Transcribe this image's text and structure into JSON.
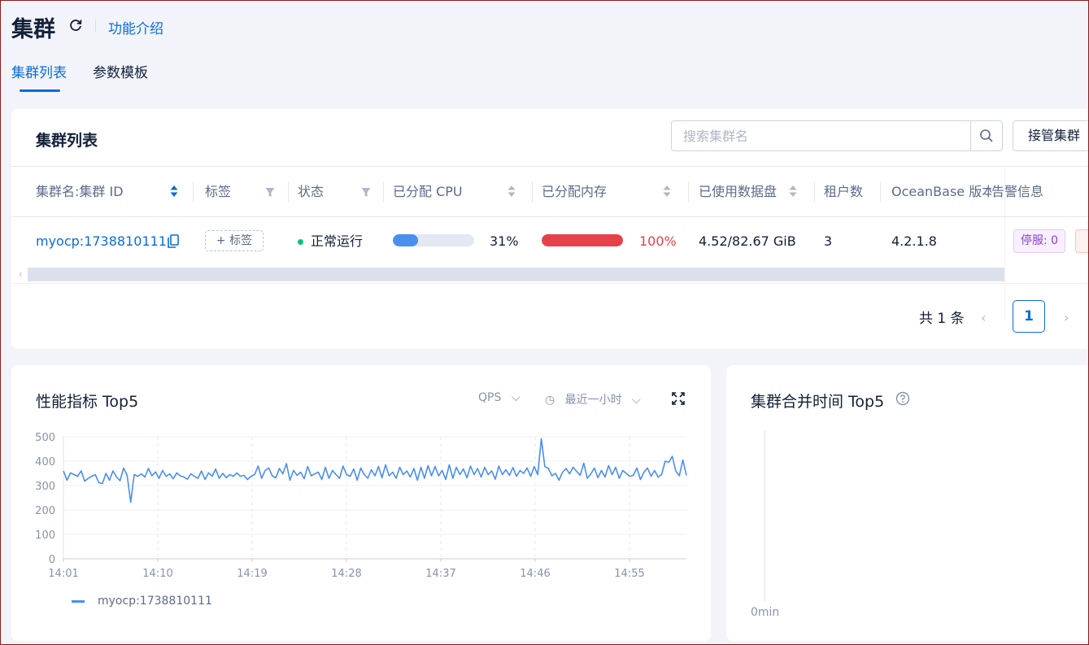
{
  "header": {
    "title": "集群",
    "intro_link": "功能介绍",
    "tabs": [
      {
        "label": "集群列表",
        "active": true
      },
      {
        "label": "参数模板",
        "active": false
      }
    ]
  },
  "cluster_list": {
    "title": "集群列表",
    "search_placeholder": "搜索集群名",
    "takeover_button": "接管集群",
    "columns": [
      "集群名:集群 ID",
      "标签",
      "状态",
      "已分配 CPU",
      "已分配内存",
      "已使用数据盘",
      "租户数",
      "OceanBase 版本号",
      "告警信息"
    ],
    "rows": [
      {
        "name": "myocp:1738810111",
        "tag_button": "标签",
        "status": "正常运行",
        "cpu_pct_label": "31%",
        "cpu_fraction": 0.31,
        "mem_pct_label": "100%",
        "mem_fraction": 1.0,
        "disk": "4.52/82.67 GiB",
        "tenants": "3",
        "version": "4.2.1.8",
        "alarm": "停服: 0"
      }
    ],
    "pagination": {
      "total": "共 1 条",
      "current": "1"
    }
  },
  "colors": {
    "accent": "#0a6cdb",
    "cpu_bar": "#4a8ef0",
    "mem_bar": "#e6414a",
    "status_ok": "#0ac185",
    "series": "#4a8ef0"
  },
  "perf": {
    "title": "性能指标 Top5",
    "metric": "QPS",
    "time_range": "最近一小时",
    "chart_data": {
      "type": "line",
      "x_ticks": [
        "14:01",
        "14:10",
        "14:19",
        "14:28",
        "14:37",
        "14:46",
        "14:55"
      ],
      "y_ticks": [
        "0",
        "100",
        "200",
        "300",
        "400",
        "500"
      ],
      "ylim": [
        0,
        500
      ],
      "grid": true,
      "legend_position": "bottom-left",
      "series": [
        {
          "name": "myocp:1738810111",
          "values": [
            360,
            322,
            352,
            345,
            338,
            360,
            318,
            330,
            338,
            345,
            312,
            308,
            350,
            322,
            360,
            335,
            320,
            372,
            342,
            232,
            345,
            338,
            348,
            335,
            370,
            340,
            356,
            330,
            362,
            338,
            348,
            328,
            352,
            340,
            335,
            326,
            348,
            338,
            330,
            360,
            325,
            352,
            338,
            368,
            330,
            350,
            332,
            345,
            338,
            352,
            338,
            342,
            325,
            338,
            345,
            380,
            330,
            362,
            372,
            340,
            332,
            370,
            348,
            390,
            322,
            362,
            342,
            355,
            328,
            378,
            340,
            348,
            355,
            325,
            375,
            330,
            362,
            345,
            330,
            380,
            345,
            338,
            368,
            322,
            372,
            345,
            330,
            365,
            340,
            378,
            332,
            385,
            340,
            355,
            330,
            375,
            345,
            360,
            335,
            370,
            322,
            375,
            330,
            382,
            340,
            378,
            340,
            362,
            325,
            385,
            330,
            375,
            345,
            368,
            332,
            380,
            345,
            370,
            335,
            375,
            345,
            360,
            326,
            380,
            345,
            365,
            342,
            374,
            338,
            362,
            350,
            372,
            338,
            378,
            345,
            492,
            378,
            370,
            340,
            350,
            322,
            355,
            370,
            348,
            375,
            358,
            342,
            392,
            330,
            348,
            372,
            332,
            362,
            335,
            382,
            345,
            375,
            330,
            362,
            350,
            338,
            342,
            372,
            325,
            355,
            372,
            338,
            362,
            335,
            345,
            400,
            395,
            420,
            360,
            340,
            405,
            342
          ]
        }
      ]
    }
  },
  "merge": {
    "title": "集群合并时间 Top5",
    "y_zero_label": "0min"
  }
}
